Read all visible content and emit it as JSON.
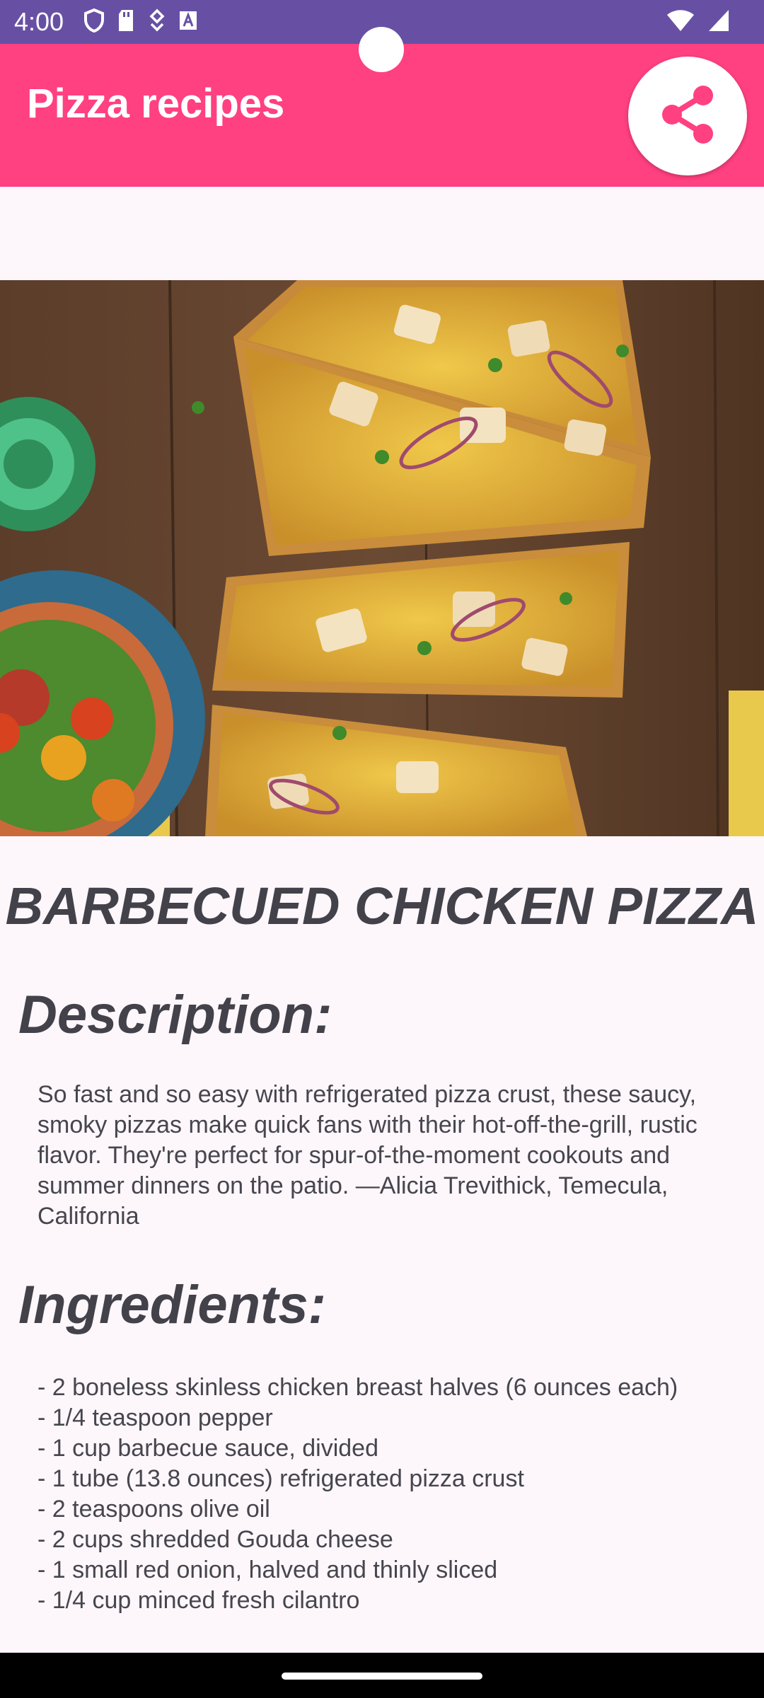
{
  "status_bar": {
    "time": "4:00",
    "left_icons": [
      "shield-icon",
      "sd-card-icon",
      "data-saver-icon",
      "keyboard-a-icon"
    ],
    "right_icons": [
      "wifi-icon",
      "signal-icon"
    ],
    "background": "#6750a4"
  },
  "app_bar": {
    "title": "Pizza recipes",
    "background": "#ff4081",
    "share_icon": "share-icon"
  },
  "recipe": {
    "image_alt": "barbecued-chicken-pizza-photo",
    "title": "BARBECUED CHICKEN PIZZA",
    "description_heading": "Description:",
    "description": "So fast and so easy with refrigerated pizza crust, these saucy, smoky pizzas make quick fans with their hot-off-the-grill, rustic flavor. They're perfect for spur-of-the-moment cookouts and summer dinners on the patio. —Alicia Trevithick, Temecula, California",
    "ingredients_heading": "Ingredients:",
    "ingredients": [
      "- 2 boneless skinless chicken breast halves (6 ounces each)",
      "- 1/4 teaspoon pepper",
      "- 1 cup barbecue sauce, divided",
      "- 1 tube (13.8 ounces) refrigerated pizza crust",
      "- 2 teaspoons olive oil",
      "- 2 cups shredded Gouda cheese",
      "- 1 small red onion, halved and thinly sliced",
      "- 1/4 cup minced fresh cilantro"
    ]
  }
}
